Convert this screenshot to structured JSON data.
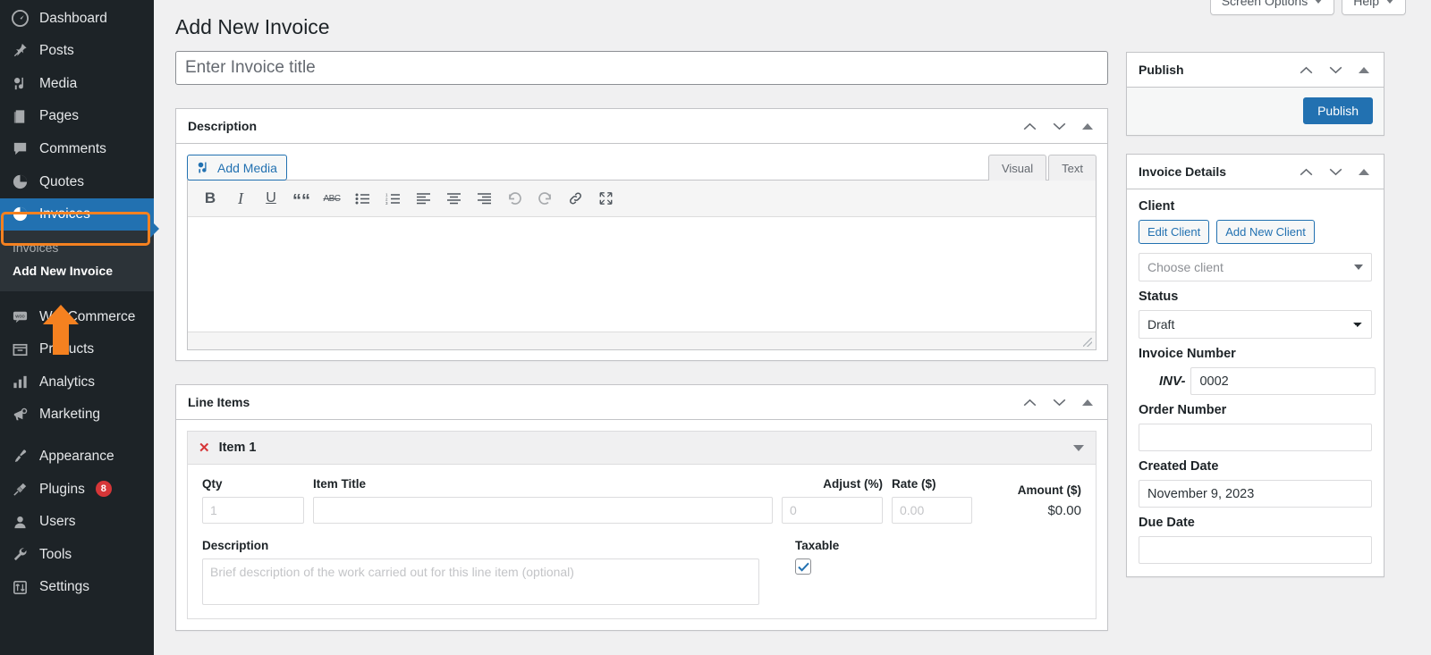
{
  "sidebar": {
    "items": [
      {
        "label": "Dashboard",
        "icon": "dashboard-icon",
        "active": false
      },
      {
        "label": "Posts",
        "icon": "pin-icon",
        "active": false
      },
      {
        "label": "Media",
        "icon": "media-icon",
        "active": false
      },
      {
        "label": "Pages",
        "icon": "page-icon",
        "active": false
      },
      {
        "label": "Comments",
        "icon": "comment-icon",
        "active": false
      },
      {
        "label": "Quotes",
        "icon": "pie-chart-icon",
        "active": false
      },
      {
        "label": "Invoices",
        "icon": "pie-chart-icon",
        "active": true
      }
    ],
    "submenu": [
      {
        "label": "Invoices",
        "current": false
      },
      {
        "label": "Add New Invoice",
        "current": true
      }
    ],
    "items2": [
      {
        "label": "WooCommerce",
        "icon": "woo-icon"
      },
      {
        "label": "Products",
        "icon": "products-icon"
      },
      {
        "label": "Analytics",
        "icon": "analytics-icon"
      },
      {
        "label": "Marketing",
        "icon": "megaphone-icon"
      }
    ],
    "items3": [
      {
        "label": "Appearance",
        "icon": "paintbrush-icon",
        "badge": ""
      },
      {
        "label": "Plugins",
        "icon": "plug-icon",
        "badge": "8"
      },
      {
        "label": "Users",
        "icon": "user-icon",
        "badge": ""
      },
      {
        "label": "Tools",
        "icon": "wrench-icon",
        "badge": ""
      },
      {
        "label": "Settings",
        "icon": "settings-icon",
        "badge": ""
      }
    ]
  },
  "topbar": {
    "screen_options": "Screen Options",
    "help": "Help"
  },
  "page": {
    "title": "Add New Invoice",
    "title_input_placeholder": "Enter Invoice title",
    "title_input_value": ""
  },
  "description_panel": {
    "title": "Description",
    "add_media": "Add Media",
    "tab_visual": "Visual",
    "tab_text": "Text",
    "toolbar": [
      {
        "name": "bold-icon",
        "glyph": "B"
      },
      {
        "name": "italic-icon",
        "glyph": "I"
      },
      {
        "name": "underline-icon",
        "glyph": "U"
      },
      {
        "name": "blockquote-icon",
        "glyph": "“"
      },
      {
        "name": "strikethrough-icon",
        "glyph": "ABC"
      },
      {
        "name": "bullet-list-icon",
        "glyph": "list"
      },
      {
        "name": "numbered-list-icon",
        "glyph": "numlist"
      },
      {
        "name": "align-left-icon",
        "glyph": "alignleft"
      },
      {
        "name": "align-center-icon",
        "glyph": "aligncenter"
      },
      {
        "name": "align-right-icon",
        "glyph": "alignright"
      },
      {
        "name": "undo-icon",
        "glyph": "undo"
      },
      {
        "name": "redo-icon",
        "glyph": "redo"
      },
      {
        "name": "link-icon",
        "glyph": "link"
      },
      {
        "name": "fullscreen-icon",
        "glyph": "fullscreen"
      }
    ],
    "content": ""
  },
  "line_items_panel": {
    "title": "Line Items",
    "item": {
      "name": "Item 1",
      "remove_label": "✕",
      "labels": {
        "qty": "Qty",
        "item_title": "Item Title",
        "adjust": "Adjust (%)",
        "rate": "Rate ($)",
        "amount": "Amount ($)",
        "description": "Description",
        "taxable": "Taxable"
      },
      "values": {
        "qty": "",
        "item_title": "",
        "adjust": "",
        "rate": "",
        "amount": "$0.00",
        "description": "",
        "taxable_checked": true
      },
      "placeholders": {
        "qty": "1",
        "item_title": "",
        "adjust": "0",
        "rate": "0.00",
        "description": "Brief description of the work carried out for this line item (optional)"
      }
    }
  },
  "publish_panel": {
    "title": "Publish",
    "publish_button": "Publish"
  },
  "invoice_details_panel": {
    "title": "Invoice Details",
    "client_label": "Client",
    "edit_client": "Edit Client",
    "add_new_client": "Add New Client",
    "choose_client_placeholder": "Choose client",
    "status_label": "Status",
    "status_value": "Draft",
    "status_options": [
      "Draft"
    ],
    "invoice_number_label": "Invoice Number",
    "invoice_prefix": "INV-",
    "invoice_number_value": "0002",
    "order_number_label": "Order Number",
    "order_number_value": "",
    "created_date_label": "Created Date",
    "created_date_value": "November 9, 2023",
    "due_date_label": "Due Date",
    "due_date_value": ""
  },
  "colors": {
    "accent_blue": "#2271b1",
    "sidebar_bg": "#1d2327",
    "submenu_bg": "#2c3338",
    "highlight_orange": "#f58120",
    "badge_red": "#d63638",
    "page_bg": "#f0f0f1"
  }
}
